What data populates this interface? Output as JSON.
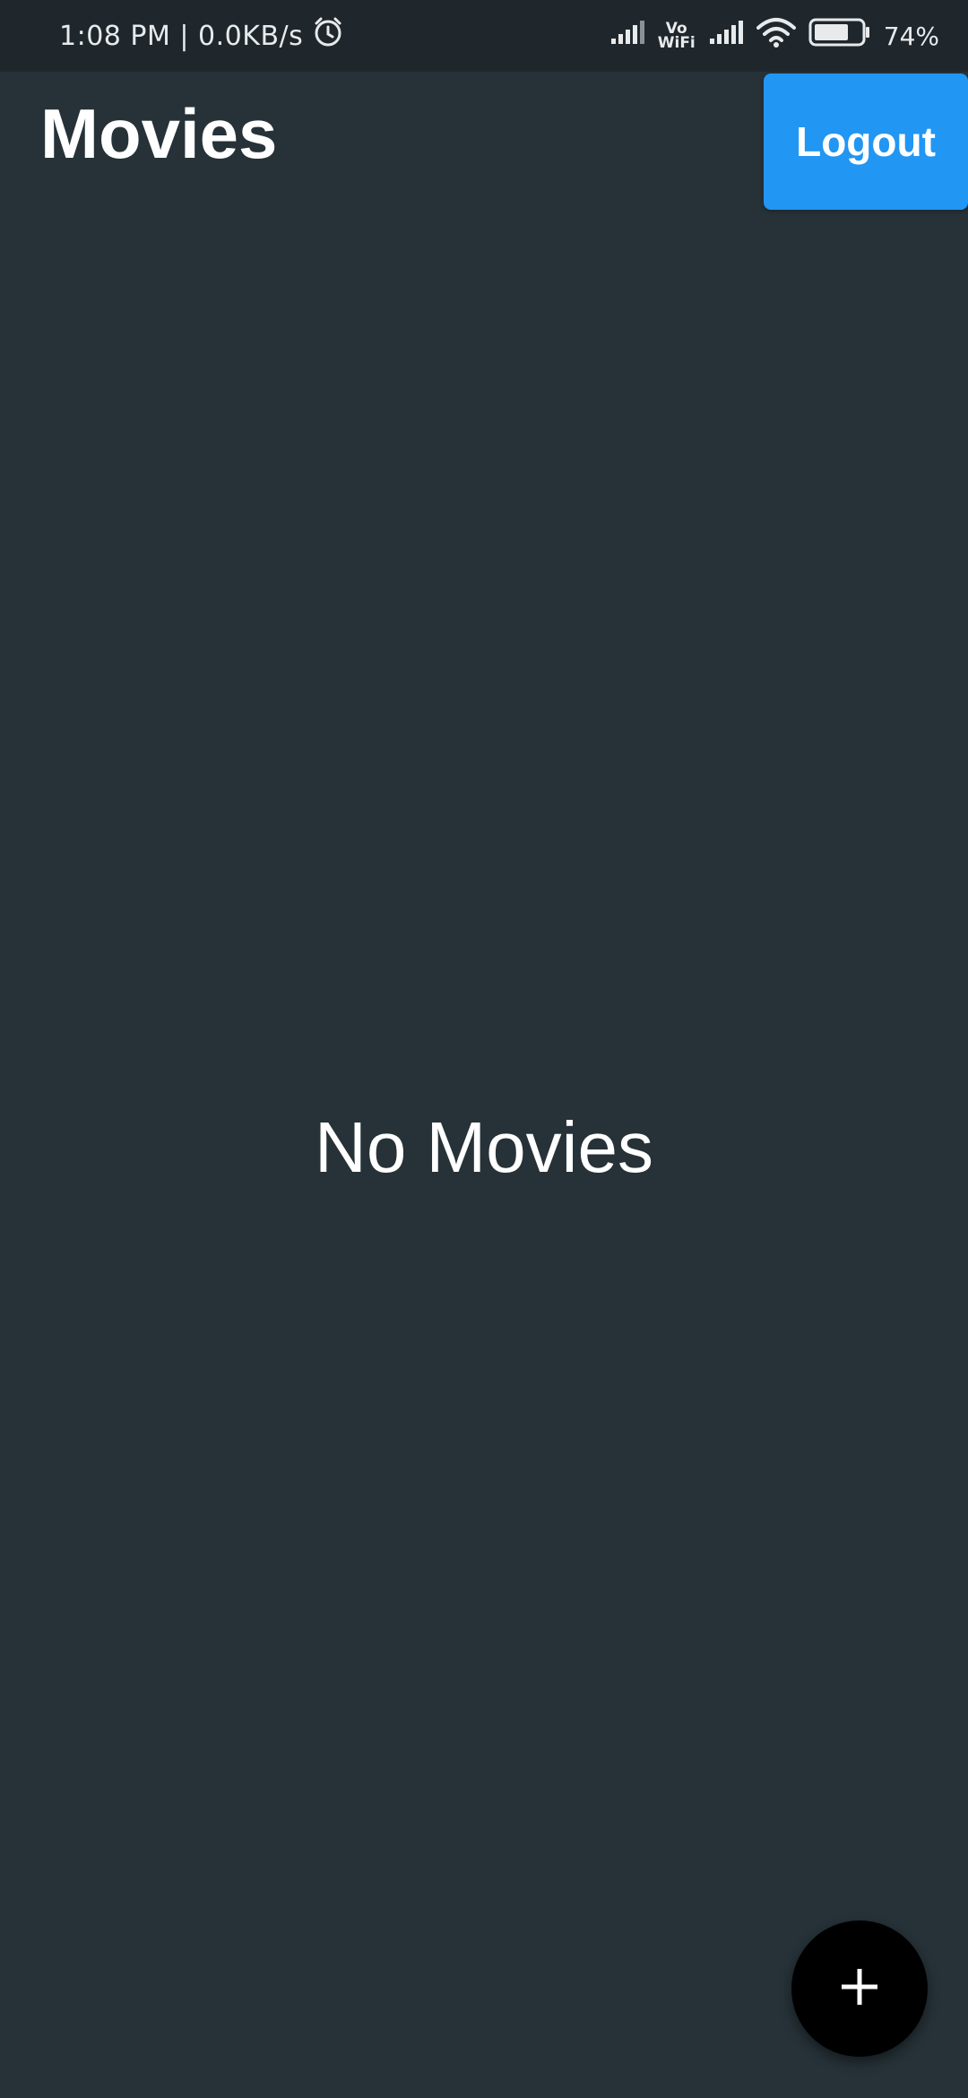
{
  "status_bar": {
    "time_speed": "1:08 PM | 0.0KB/s",
    "vowifi_top": "Vo",
    "vowifi_bottom": "WiFi",
    "battery": "74%",
    "battery_level": 0.74
  },
  "app_bar": {
    "title": "Movies",
    "logout_label": "Logout"
  },
  "main": {
    "empty_message": "No Movies"
  },
  "fab": {
    "icon": "plus-icon"
  },
  "colors": {
    "background": "#263238",
    "status_bar": "#1f272d",
    "accent": "#2196f3",
    "fab": "#000000",
    "text": "#ffffff"
  }
}
